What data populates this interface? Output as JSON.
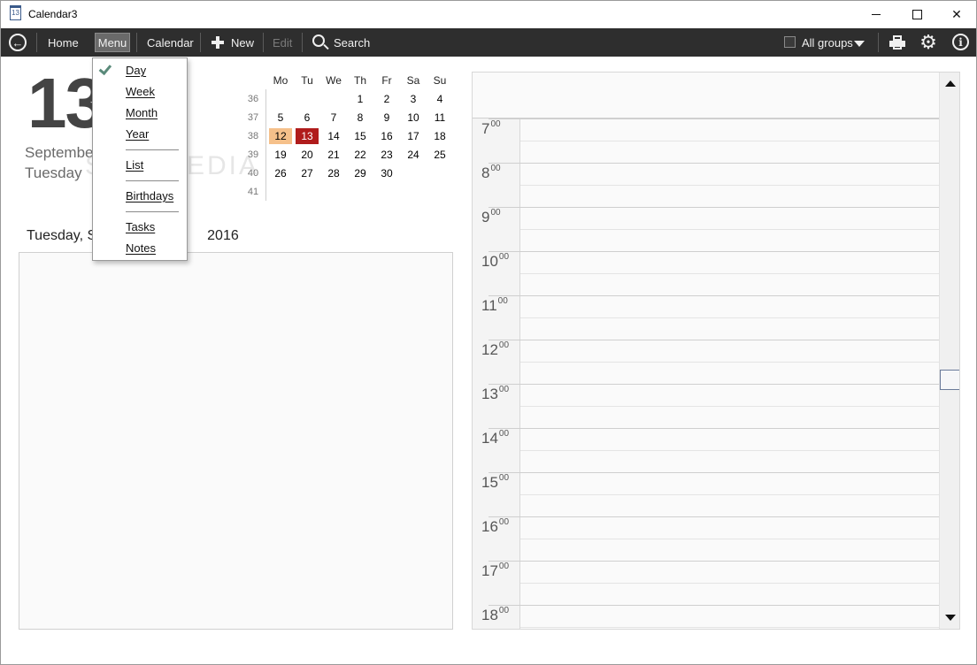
{
  "window": {
    "title": "Calendar3",
    "app_icon_text": "13"
  },
  "toolbar": {
    "home": "Home",
    "menu": "Menu",
    "calendar": "Calendar",
    "new": "New",
    "edit": "Edit",
    "search": "Search",
    "groups": "All groups"
  },
  "day_view": {
    "day_number": "13",
    "month": "September",
    "weekday": "Tuesday",
    "full_date_left": "Tuesday, S",
    "full_date_right": "2016",
    "watermark": "SOFTPEDIA"
  },
  "mini_calendar": {
    "headers": [
      "Mo",
      "Tu",
      "We",
      "Th",
      "Fr",
      "Sa",
      "Su"
    ],
    "weeks": [
      {
        "week": "36",
        "days": [
          "",
          "",
          "",
          "1",
          "2",
          "3",
          "4"
        ]
      },
      {
        "week": "37",
        "days": [
          "5",
          "6",
          "7",
          "8",
          "9",
          "10",
          "11"
        ]
      },
      {
        "week": "38",
        "days": [
          "12",
          "13",
          "14",
          "15",
          "16",
          "17",
          "18"
        ]
      },
      {
        "week": "39",
        "days": [
          "19",
          "20",
          "21",
          "22",
          "23",
          "24",
          "25"
        ]
      },
      {
        "week": "40",
        "days": [
          "26",
          "27",
          "28",
          "29",
          "30",
          "",
          ""
        ]
      },
      {
        "week": "41",
        "days": [
          "",
          "",
          "",
          "",
          "",
          "",
          ""
        ]
      }
    ],
    "selected_previous": "12",
    "today": "13",
    "colors": {
      "today": "#b01c1c",
      "previous": "#f5c08a"
    }
  },
  "menu_popup": {
    "items": [
      "Day",
      "Week",
      "Month",
      "Year",
      "List",
      "Birthdays",
      "Tasks",
      "Notes"
    ],
    "checked": "Day"
  },
  "schedule": {
    "hours": [
      {
        "hour": "7",
        "min": "00"
      },
      {
        "hour": "8",
        "min": "00"
      },
      {
        "hour": "9",
        "min": "00"
      },
      {
        "hour": "10",
        "min": "00"
      },
      {
        "hour": "11",
        "min": "00"
      },
      {
        "hour": "12",
        "min": "00"
      },
      {
        "hour": "13",
        "min": "00"
      },
      {
        "hour": "14",
        "min": "00"
      },
      {
        "hour": "15",
        "min": "00"
      },
      {
        "hour": "16",
        "min": "00"
      },
      {
        "hour": "17",
        "min": "00"
      },
      {
        "hour": "18",
        "min": "00"
      }
    ]
  }
}
